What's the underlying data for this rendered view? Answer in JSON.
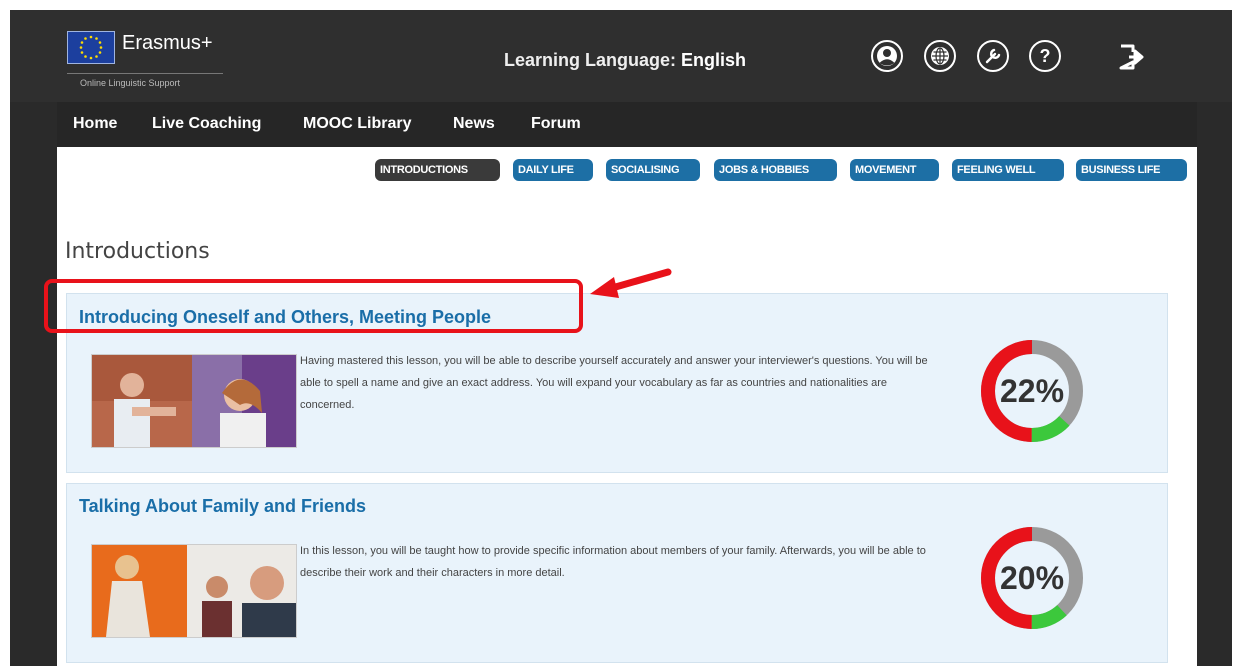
{
  "header": {
    "logo_text": "Erasmus+",
    "logo_subtext": "Online Linguistic Support",
    "language_label": "Learning Language:",
    "language_value": "English",
    "icons": [
      "user-icon",
      "globe-icon",
      "wrench-icon",
      "help-icon",
      "logout-icon"
    ]
  },
  "nav": {
    "items": [
      "Home",
      "Live Coaching",
      "MOOC Library",
      "News",
      "Forum"
    ]
  },
  "tags": {
    "items": [
      "INTRODUCTIONS",
      "DAILY LIFE",
      "SOCIALISING",
      "JOBS & HOBBIES",
      "MOVEMENT",
      "FEELING WELL",
      "BUSINESS LIFE"
    ],
    "active": "INTRODUCTIONS"
  },
  "section": {
    "title": "Introductions"
  },
  "lessons": [
    {
      "title": "Introducing Oneself and Others, Meeting People",
      "description": "Having mastered this lesson, you will be able to describe yourself accurately and answer your interviewer's questions. You will be able to spell a name and give an exact address. You will expand your vocabulary as far as countries and nationalities are concerned.",
      "progress_label": "22%",
      "progress": 0.22
    },
    {
      "title": "Talking About Family and Friends",
      "description": "In this lesson, you will be taught how to provide specific information about members of your family. Afterwards, you will be able to describe their work and their characters in more detail.",
      "progress_label": "20%",
      "progress": 0.2
    }
  ],
  "colors": {
    "accent": "#1d6fa5",
    "ring_red": "#e8121a",
    "ring_green": "#3cc83c",
    "ring_gray": "#9a9a9a",
    "highlight": "#e8121a"
  }
}
